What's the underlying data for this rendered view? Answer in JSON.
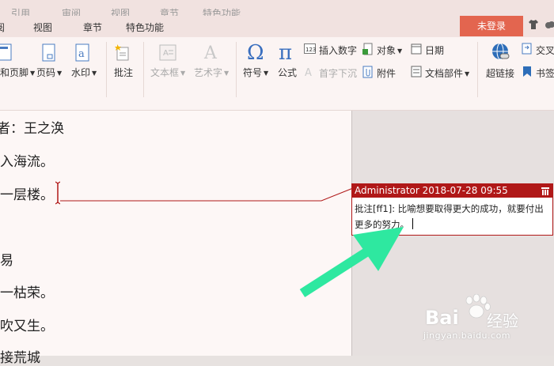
{
  "top_tabs": [
    "引用",
    "审阅",
    "视图",
    "章节",
    "特色功能"
  ],
  "tabs": [
    "阅",
    "视图",
    "章节",
    "特色功能"
  ],
  "login_label": "未登录",
  "ribbon": {
    "header_footer": "和页脚",
    "page_number": "页码",
    "watermark": "水印",
    "comment": "批注",
    "textbox": "文本框",
    "wordart": "艺术字",
    "symbol": "符号",
    "formula": "公式",
    "insert_number": "插入数字",
    "dropcap": "首字下沉",
    "object": "对象",
    "attachment": "附件",
    "date": "日期",
    "doc_parts": "文档部件",
    "hyperlink": "超链接",
    "cross_ref": "交叉",
    "bookmark": "书签"
  },
  "document_lines": [
    "者：王之涣",
    "入海流。",
    "一层楼。",
    "易",
    "一枯荣。",
    "吹又生。",
    "接荒城"
  ],
  "comment": {
    "author": "Administrator",
    "datetime": "2018-07-28 09:55",
    "text": "批注[ff1]: 比喻想要取得更大的成功，就要付出更多的努力。"
  },
  "watermark": {
    "brand": "Bai",
    "brand2": "经验",
    "url": "jingyan.baidu.com"
  },
  "colors": {
    "accent": "#b01818",
    "login": "#e3654f",
    "arrow": "#2ee8a0"
  }
}
